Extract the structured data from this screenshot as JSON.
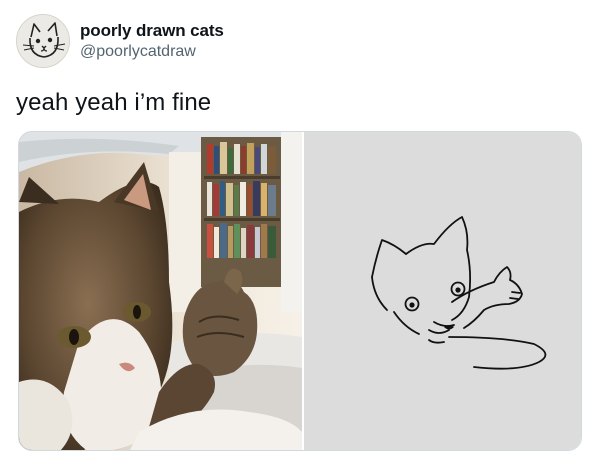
{
  "author": {
    "display_name": "poorly drawn cats",
    "handle": "@poorlycatdraw"
  },
  "tweet": {
    "text": "yeah yeah i’m fine"
  },
  "media": {
    "photos": [
      {
        "label": "cat-thumbs-up-photo"
      },
      {
        "label": "cat-thumbs-up-drawing"
      }
    ]
  }
}
